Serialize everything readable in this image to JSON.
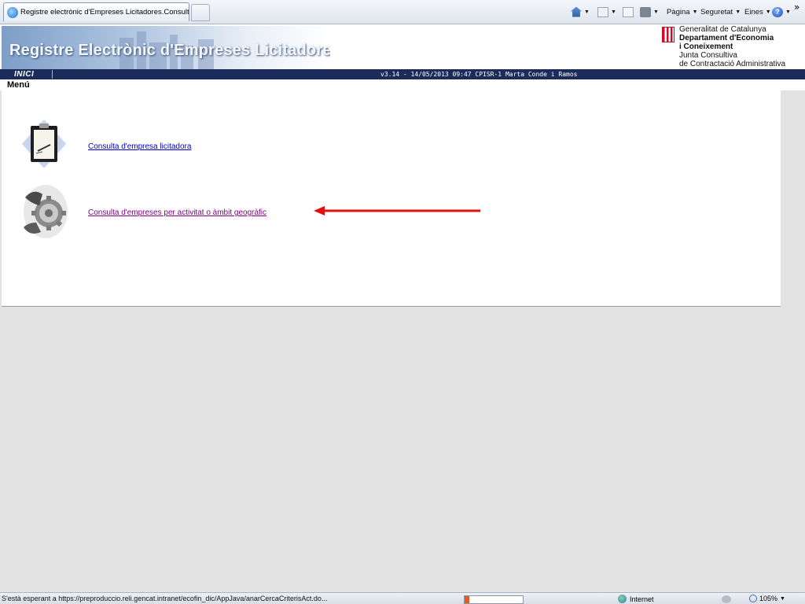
{
  "browser": {
    "tab_title": "Registre electrònic d'Empreses Licitadores.Consulta A...",
    "toolbar": {
      "page_label": "Pàgina",
      "security_label": "Seguretat",
      "tools_label": "Eines",
      "overflow": "»"
    }
  },
  "header": {
    "title": "Registre Electrònic d'Empreses Licitadores",
    "org_line1": "Generalitat de Catalunya",
    "org_line2": "Departament d'Economia",
    "org_line3": "i Coneixement",
    "org_line4": "Junta Consultiva",
    "org_line5": "de Contractació Administrativa"
  },
  "nav": {
    "home_label": "INICI",
    "status": "v3.14 - 14/05/2013 09:47 CPISR-1 Marta Conde i Ramos"
  },
  "menu": {
    "label": "Menú",
    "items": [
      {
        "label": "Consulta d'empresa licitadora ",
        "icon": "clipboard-icon"
      },
      {
        "label": "Consulta d'empreses per activitat o àmbit geogràfic ",
        "icon": "gears-icon"
      }
    ]
  },
  "statusbar": {
    "text": "S'està esperant a https://preproduccio.reli.gencat.intranet/ecofin_dic/AppJava/anarCercaCriterisAct.do...",
    "zone": "Internet",
    "zoom": "105%",
    "progress": 0.08
  },
  "colors": {
    "nav_bg": "#1c2c5a",
    "link_unvisited": "#0000cc",
    "link_visited": "#800080",
    "arrow": "#e01010"
  }
}
